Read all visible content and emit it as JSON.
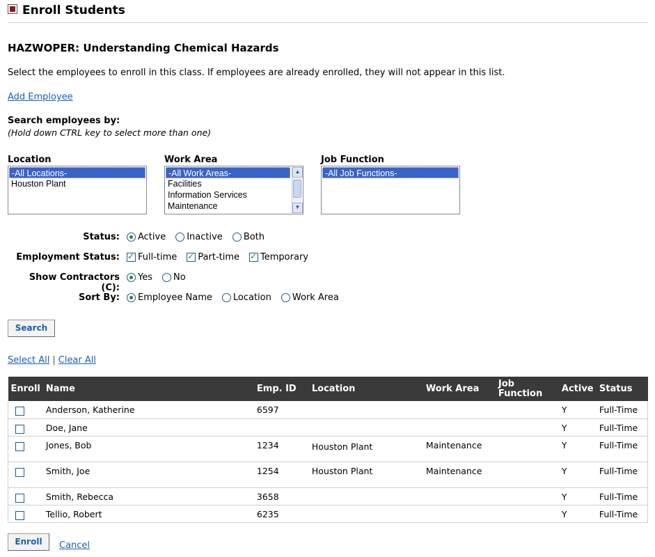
{
  "header": {
    "title": "Enroll Students"
  },
  "course": {
    "title": "HAZWOPER: Understanding Chemical Hazards"
  },
  "instructions": "Select the employees to enroll in this class. If employees are already enrolled, they will not appear in this list.",
  "add_employee_link": "Add Employee",
  "search": {
    "heading": "Search employees by:",
    "hint": "(Hold down CTRL key to select more than one)",
    "location": {
      "label": "Location",
      "options": [
        "-All Locations-",
        "Houston Plant"
      ],
      "selected": "-All Locations-"
    },
    "work_area": {
      "label": "Work Area",
      "options": [
        "-All Work Areas-",
        "Facilities",
        "Information Services",
        "Maintenance"
      ],
      "selected": "-All Work Areas-"
    },
    "job_function": {
      "label": "Job Function",
      "options": [
        "-All Job Functions-"
      ],
      "selected": "-All Job Functions-"
    }
  },
  "filters": {
    "status": {
      "label": "Status:",
      "options": [
        "Active",
        "Inactive",
        "Both"
      ],
      "selected": "Active"
    },
    "employment_status": {
      "label": "Employment Status:",
      "options": [
        "Full-time",
        "Part-time",
        "Temporary"
      ],
      "checked": [
        "Full-time",
        "Part-time",
        "Temporary"
      ]
    },
    "show_contractors": {
      "label": "Show Contractors (C):",
      "options": [
        "Yes",
        "No"
      ],
      "selected": "Yes"
    },
    "sort_by": {
      "label": "Sort By:",
      "options": [
        "Employee Name",
        "Location",
        "Work Area"
      ],
      "selected": "Employee Name"
    }
  },
  "search_button": "Search",
  "select_all": "Select All",
  "separator": "|",
  "clear_all": "Clear All",
  "table": {
    "columns": [
      "Enroll",
      "Name",
      "Emp. ID",
      "Location",
      "Work Area",
      "Job Function",
      "Active",
      "Status"
    ],
    "rows": [
      {
        "name": "Anderson, Katherine",
        "emp_id": "6597",
        "location": "",
        "work_area": "",
        "job_function": "",
        "active": "Y",
        "status": "Full-Time"
      },
      {
        "name": "Doe, Jane",
        "emp_id": "",
        "location": "",
        "work_area": "",
        "job_function": "",
        "active": "Y",
        "status": "Full-Time"
      },
      {
        "name": "Jones, Bob",
        "emp_id": "1234",
        "location": "Houston Plant",
        "work_area": "Maintenance",
        "job_function": "",
        "active": "Y",
        "status": "Full-Time"
      },
      {
        "name": "Smith, Joe",
        "emp_id": "1254",
        "location": "Houston Plant",
        "work_area": "Maintenance",
        "job_function": "",
        "active": "Y",
        "status": "Full-Time"
      },
      {
        "name": "Smith, Rebecca",
        "emp_id": "3658",
        "location": "",
        "work_area": "",
        "job_function": "",
        "active": "Y",
        "status": "Full-Time"
      },
      {
        "name": "Tellio, Robert",
        "emp_id": "6235",
        "location": "",
        "work_area": "",
        "job_function": "",
        "active": "Y",
        "status": "Full-Time"
      }
    ]
  },
  "enroll_button": "Enroll",
  "cancel_link": "Cancel",
  "colors": {
    "header_bg": "#3a3a3a",
    "link": "#1a5fb4",
    "listbox_selected": "#3a63c6",
    "icon_red": "#8b1a1a"
  }
}
